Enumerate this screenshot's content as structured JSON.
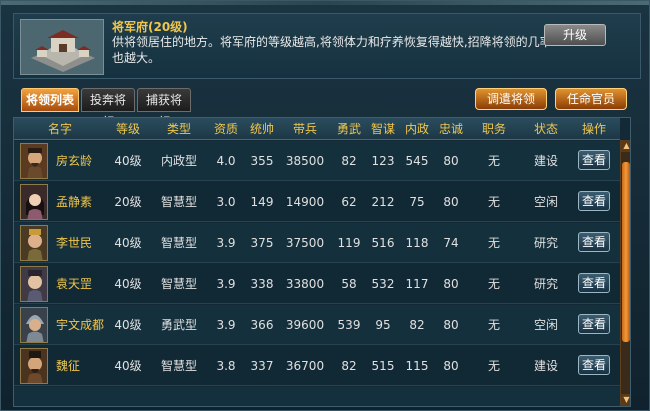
{
  "building": {
    "title": "将军府(20级)",
    "description": "供将领居住的地方。将军府的等级越高,将领体力和疗养恢复得越快,招降将领的几率也越大。",
    "upgrade_label": "升级"
  },
  "tabs": [
    {
      "label": "将领列表",
      "active": true
    },
    {
      "label": "投奔将领",
      "active": false
    },
    {
      "label": "捕获将领",
      "active": false
    }
  ],
  "actions": {
    "dispatch_label": "调遣将领",
    "appoint_label": "任命官员"
  },
  "columns": [
    "名字",
    "等级",
    "类型",
    "资质",
    "统帅",
    "带兵",
    "勇武",
    "智谋",
    "内政",
    "忠诚",
    "职务",
    "状态",
    "操作"
  ],
  "rows": [
    {
      "name": "房玄龄",
      "level": "40级",
      "type": "内政型",
      "aptitude": "4.0",
      "command": "355",
      "troops": "38500",
      "valor": "82",
      "wisdom": "123",
      "politics": "545",
      "loyalty": "80",
      "post": "无",
      "status": "建设",
      "action": "查看"
    },
    {
      "name": "孟静素",
      "level": "20级",
      "type": "智慧型",
      "aptitude": "3.0",
      "command": "149",
      "troops": "14900",
      "valor": "62",
      "wisdom": "212",
      "politics": "75",
      "loyalty": "80",
      "post": "无",
      "status": "空闲",
      "action": "查看"
    },
    {
      "name": "李世民",
      "level": "40级",
      "type": "智慧型",
      "aptitude": "3.9",
      "command": "375",
      "troops": "37500",
      "valor": "119",
      "wisdom": "516",
      "politics": "118",
      "loyalty": "74",
      "post": "无",
      "status": "研究",
      "action": "查看"
    },
    {
      "name": "袁天罡",
      "level": "40级",
      "type": "智慧型",
      "aptitude": "3.9",
      "command": "338",
      "troops": "33800",
      "valor": "58",
      "wisdom": "532",
      "politics": "117",
      "loyalty": "80",
      "post": "无",
      "status": "研究",
      "action": "查看"
    },
    {
      "name": "宇文成都",
      "level": "40级",
      "type": "勇武型",
      "aptitude": "3.9",
      "command": "366",
      "troops": "39600",
      "valor": "539",
      "wisdom": "95",
      "politics": "82",
      "loyalty": "80",
      "post": "无",
      "status": "空闲",
      "action": "查看"
    },
    {
      "name": "魏征",
      "level": "40级",
      "type": "智慧型",
      "aptitude": "3.8",
      "command": "337",
      "troops": "36700",
      "valor": "82",
      "wisdom": "515",
      "politics": "115",
      "loyalty": "80",
      "post": "无",
      "status": "建设",
      "action": "查看"
    }
  ],
  "colors": {
    "accent_gold": "#f0c64b",
    "tab_active": "#e0932f",
    "panel_bg": "#132a36"
  }
}
